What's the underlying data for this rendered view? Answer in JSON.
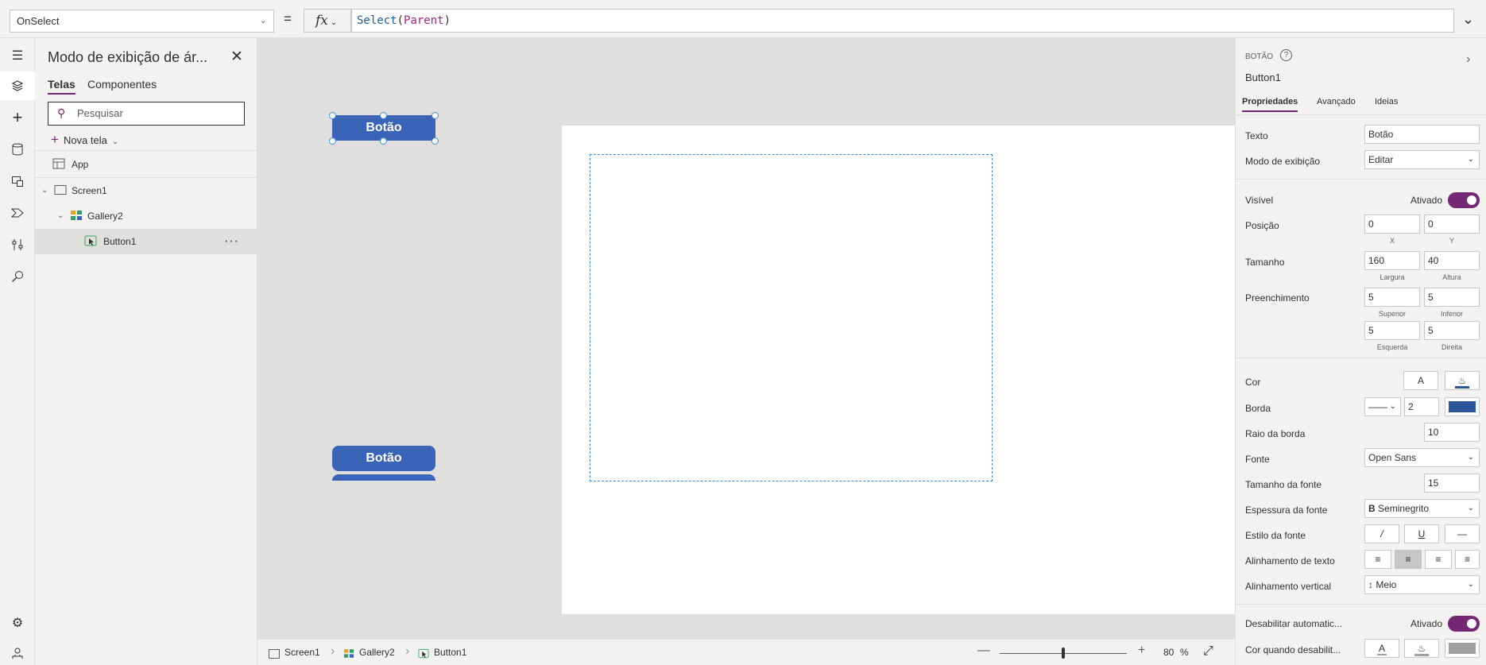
{
  "formula": {
    "property": "OnSelect",
    "equals": "=",
    "fx": "fx",
    "function": "Select",
    "open_paren": "(",
    "argument": "Parent",
    "close_paren": ")"
  },
  "tree": {
    "title": "Modo de exibição de ár...",
    "tabs": [
      "Telas",
      "Componentes"
    ],
    "search_placeholder": "Pesquisar",
    "new_screen": "Nova tela",
    "items": [
      {
        "label": "App"
      },
      {
        "label": "Screen1"
      },
      {
        "label": "Gallery2"
      },
      {
        "label": "Button1"
      }
    ],
    "more": "···"
  },
  "canvas": {
    "button_text": "Botão"
  },
  "status": {
    "breadcrumbs": [
      "Screen1",
      "Gallery2",
      "Button1"
    ],
    "zoom": "80",
    "zoom_unit": "%",
    "zoom_fraction": 0.5
  },
  "props": {
    "control_type": "BOTÃO",
    "help": "?",
    "control_name": "Button1",
    "tabs": [
      "Propriedades",
      "Avançado",
      "Ideias"
    ],
    "text_label": "Texto",
    "text_value": "Botão",
    "display_mode_label": "Modo de exibição",
    "display_mode_value": "Editar",
    "visible_label": "Visível",
    "visible_state": "Ativado",
    "position_label": "Posição",
    "position_x": "0",
    "position_y": "0",
    "x_cap": "X",
    "y_cap": "Y",
    "size_label": "Tamanho",
    "width": "160",
    "height": "40",
    "width_cap": "Largura",
    "height_cap": "Altura",
    "padding_label": "Preenchimento",
    "pad_top": "5",
    "pad_bottom": "5",
    "pad_left": "5",
    "pad_right": "5",
    "pad_top_cap": "Superior",
    "pad_bottom_cap": "Inferior",
    "pad_left_cap": "Esquerda",
    "pad_right_cap": "Direita",
    "color_label": "Cor",
    "color_text_glyph": "A",
    "border_label": "Borda",
    "border_width": "2",
    "border_color": "#2b579a",
    "radius_label": "Raio da borda",
    "radius_value": "10",
    "font_label": "Fonte",
    "font_value": "Open Sans",
    "font_size_label": "Tamanho da fonte",
    "font_size_value": "15",
    "font_weight_label": "Espessura da fonte",
    "font_weight_glyph": "B",
    "font_weight_value": "Seminegrito",
    "font_style_label": "Estilo da fonte",
    "italic_glyph": "/",
    "underline_glyph": "U",
    "text_align_label": "Alinhamento de texto",
    "vertical_align_label": "Alinhamento vertical",
    "vertical_align_value": "Meio",
    "auto_disable_label": "Desabilitar automatic...",
    "auto_disable_state": "Ativado",
    "disabled_color_label": "Cor quando desabilit...",
    "disabled_text_glyph": "A"
  },
  "colors": {
    "accent": "#742774",
    "button": "#3a64b8",
    "selection": "#3b8fd9"
  }
}
